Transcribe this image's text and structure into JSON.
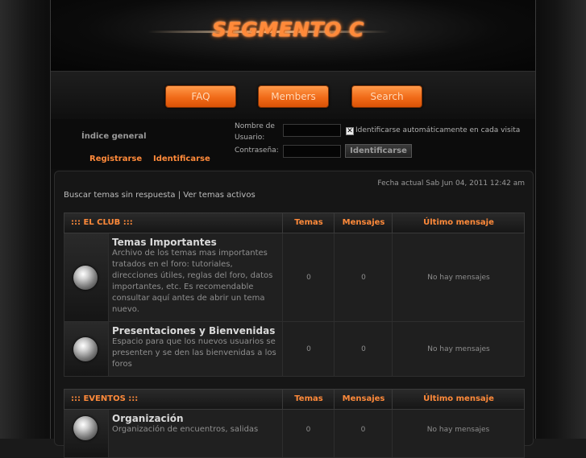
{
  "header": {
    "logo_text": "SEGMENTO C"
  },
  "nav": {
    "faq": "FAQ",
    "members": "Members",
    "search": "Search"
  },
  "login": {
    "index_label": "Índice general",
    "username_label": "Nombre de Usuario:",
    "password_label": "Contraseña:",
    "auto_login_label": "Identificarse automáticamente en cada visita",
    "auto_login_checked": true,
    "login_button": "Identificarse",
    "register_link": "Registrarse",
    "login_link": "Identificarse"
  },
  "content": {
    "date": "Fecha actual Sab Jun 04, 2011 12:42 am",
    "unanswered": "Buscar temas sin respuesta",
    "separator": "|",
    "active": "Ver temas activos"
  },
  "categories": [
    {
      "title": "::: EL CLUB :::",
      "col_topics": "Temas",
      "col_posts": "Mensajes",
      "col_last": "Último mensaje",
      "forums": [
        {
          "title": "Temas Importantes",
          "desc": "Archivo de los temas mas importantes tratados en el foro: tutoriales, direcciones útiles, reglas del foro, datos importantes, etc. Es recomendable consultar aquí antes de abrir un tema nuevo.",
          "topics": "0",
          "posts": "0",
          "last": "No hay mensajes"
        },
        {
          "title": "Presentaciones y Bienvenidas",
          "desc": "Espacio para que los nuevos usuarios se presenten y se den las bienvenidas a los foros",
          "topics": "0",
          "posts": "0",
          "last": "No hay mensajes"
        }
      ]
    },
    {
      "title": "::: EVENTOS :::",
      "col_topics": "Temas",
      "col_posts": "Mensajes",
      "col_last": "Último mensaje",
      "forums": [
        {
          "title": "Organización",
          "desc": "Organización de encuentros, salidas",
          "topics": "0",
          "posts": "0",
          "last": "No hay mensajes"
        }
      ]
    }
  ],
  "colors": {
    "accent": "#ff8a3a",
    "background": "#0e0e0e"
  }
}
